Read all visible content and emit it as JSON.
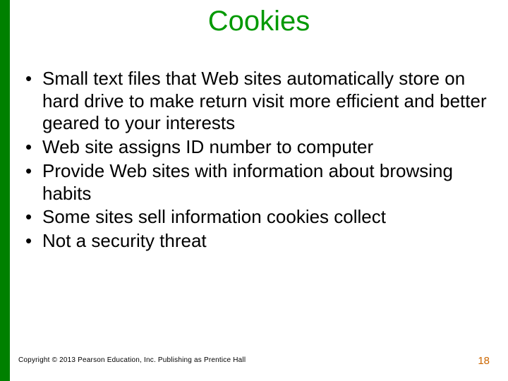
{
  "slide": {
    "title": "Cookies",
    "bullets": [
      "Small text files that Web sites automatically store on hard drive to make return visit more efficient and better geared to your interests",
      "Web site assigns ID number to computer",
      "Provide Web sites with information about browsing habits",
      "Some sites sell information cookies collect",
      "Not a security threat"
    ],
    "copyright": "Copyright © 2013 Pearson Education, Inc. Publishing as Prentice Hall",
    "page_number": "18"
  },
  "colors": {
    "accent_green": "#008000",
    "title_green": "#009900",
    "page_num_orange": "#cc6600"
  }
}
